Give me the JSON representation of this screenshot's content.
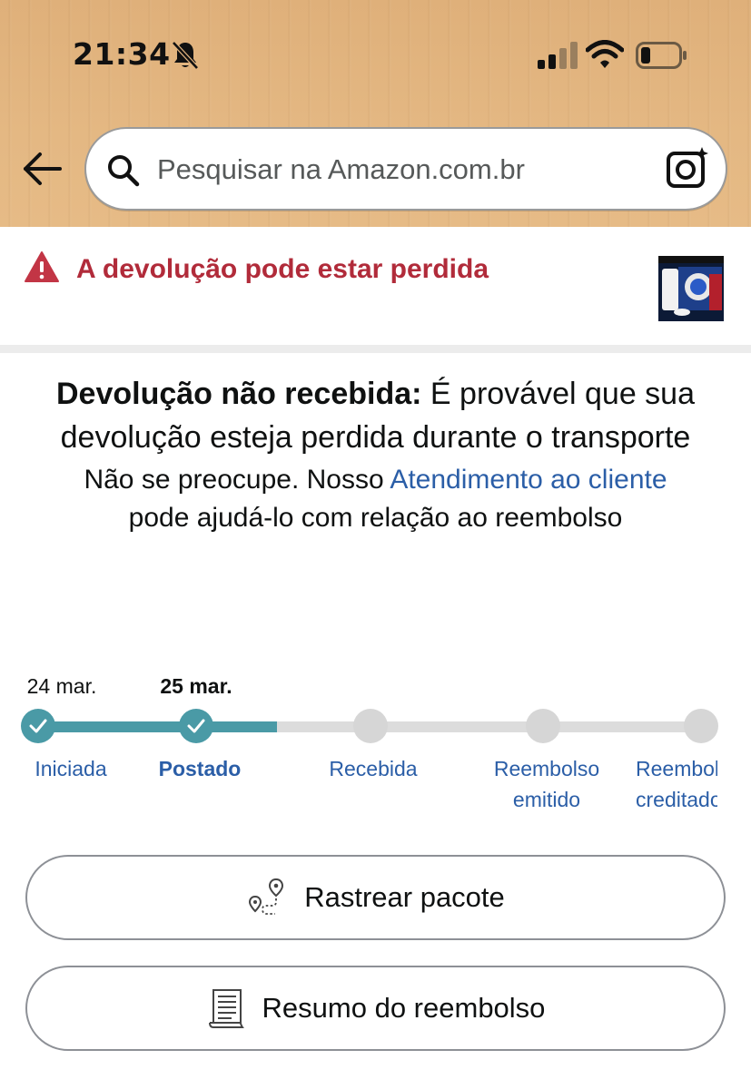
{
  "status_bar": {
    "time": "21:34",
    "icons": [
      "bell-slash-icon",
      "cellular-signal-icon",
      "wifi-icon",
      "battery-icon"
    ]
  },
  "search": {
    "placeholder": "Pesquisar na Amazon.com.br",
    "value": "",
    "icons": [
      "back-arrow-icon",
      "search-icon",
      "camera-lens-icon"
    ]
  },
  "alert": {
    "icon": "warning-triangle-icon",
    "text": "A devolução pode estar perdida",
    "color": "#b12b3a"
  },
  "message": {
    "title_bold": "Devolução não recebida:",
    "title_rest": " É provável que sua devolução esteja perdida durante o transporte",
    "sub_before": "Não se preocupe. Nosso ",
    "sub_link": "Atendimento ao cliente",
    "sub_after": " pode ajudá-lo com relação ao reembolso"
  },
  "tracker": {
    "dates": [
      "24 mar.",
      "25 mar."
    ],
    "steps": [
      {
        "label": "Iniciada",
        "status": "done"
      },
      {
        "label": "Postado",
        "status": "done"
      },
      {
        "label": "Recebida",
        "status": "pending"
      },
      {
        "label": "Reembolso emitido",
        "status": "pending"
      },
      {
        "label": "Reembolso creditado",
        "status": "pending"
      }
    ],
    "progress_fraction": 0.36,
    "accent_color": "#4a9aa6"
  },
  "buttons": {
    "track_label": "Rastrear pacote",
    "track_icon": "route-pin-icon",
    "refund_label": "Resumo do reembolso",
    "refund_icon": "receipt-icon"
  },
  "colors": {
    "link": "#2b5ea7",
    "header_bg": "#e2b47f"
  }
}
